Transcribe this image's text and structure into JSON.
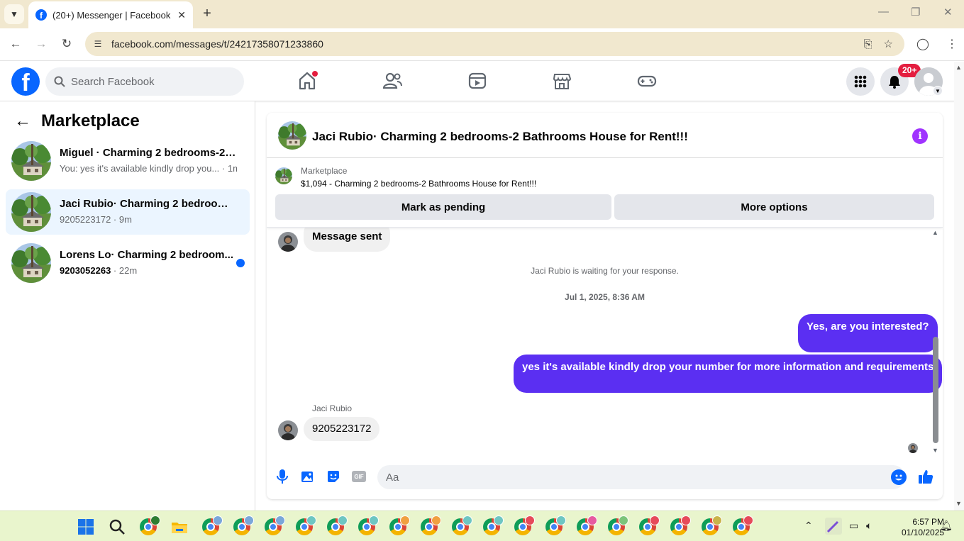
{
  "browser": {
    "tab_title": "(20+) Messenger | Facebook",
    "url": "facebook.com/messages/t/24217358071233860"
  },
  "fb_header": {
    "logo_letter": "f",
    "search_placeholder": "Search Facebook",
    "notification_badge": "20+"
  },
  "sidebar": {
    "title": "Marketplace",
    "conversations": [
      {
        "name": "Miguel · Charming 2 bedrooms-2 ...",
        "preview": "You: yes it's available kindly drop you...",
        "time": "· 1m",
        "active": false,
        "unread": false
      },
      {
        "name": "Jaci Rubio· Charming 2 bedrooms-...",
        "preview": "9205223172",
        "time": " · 9m",
        "active": true,
        "unread": false
      },
      {
        "name": "Lorens Lo· Charming 2 bedroom...",
        "preview": "9203052263",
        "time": " · 22m",
        "active": false,
        "unread": true
      }
    ]
  },
  "chat": {
    "title": "Jaci Rubio· Charming 2 bedrooms-2 Bathrooms House for Rent!!!",
    "listing": {
      "kicker": "Marketplace",
      "description": "$1,094 - Charming 2 bedrooms-2 Bathrooms House for Rent!!!",
      "pending_label": "Mark as pending",
      "more_label": "More options"
    },
    "messages": {
      "first_incoming": "Message sent",
      "waiting_notice": "Jaci Rubio is waiting for your response.",
      "timestamp": "Jul 1, 2025, 8:36 AM",
      "outgoing_1": "Yes, are you interested?",
      "outgoing_2": "yes it's available kindly drop your number for more information and requirements",
      "sender_name": "Jaci Rubio",
      "last_incoming": "9205223172"
    },
    "composer_placeholder": "Aa"
  },
  "taskbar": {
    "time": "6:57 PM",
    "date": "01/10/2025"
  },
  "colors": {
    "fb_blue": "#0866ff",
    "outgoing_bubble": "#5b2ff2",
    "active_conversation": "#ebf5ff",
    "info_purple": "#a033ff"
  }
}
